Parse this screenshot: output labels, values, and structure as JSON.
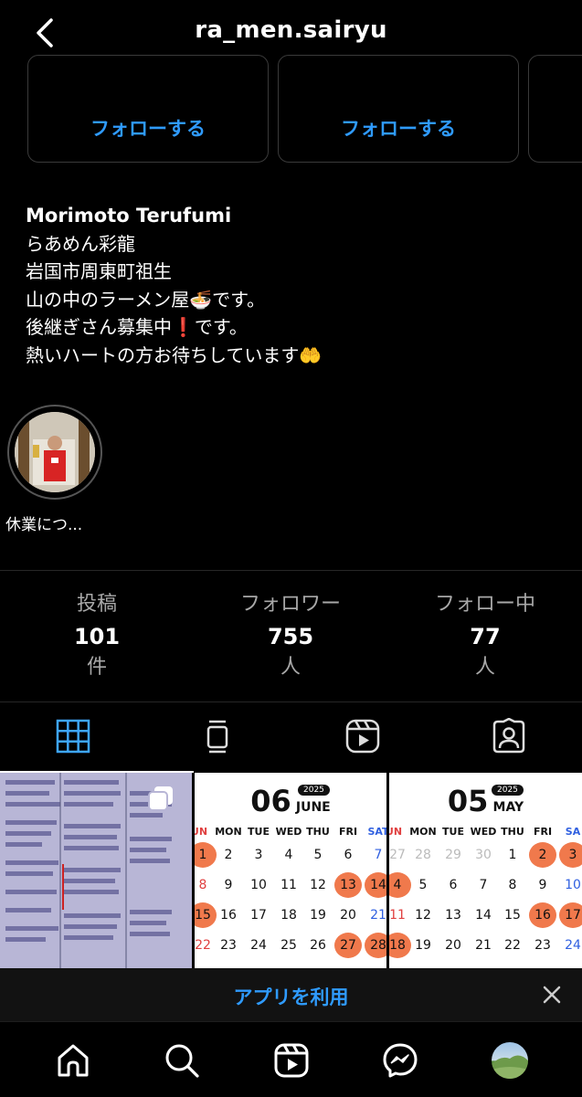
{
  "header": {
    "username": "ra_men.sairyu"
  },
  "suggestions": [
    {
      "follow_label": "フォローする"
    },
    {
      "follow_label": "フォローする"
    }
  ],
  "bio": {
    "name": "Morimoto Terufumi",
    "lines": [
      "らあめん彩龍",
      "岩国市周東町祖生",
      "山の中のラーメン屋🍜です。",
      "後継ぎさん募集中❗️です。",
      "熱いハートの方お待ちしています🤲"
    ]
  },
  "highlights": [
    {
      "label": "休業につ..."
    }
  ],
  "stats": [
    {
      "label": "投稿",
      "value": "101",
      "unit": "件"
    },
    {
      "label": "フォロワー",
      "value": "755",
      "unit": "人"
    },
    {
      "label": "フォロー中",
      "value": "77",
      "unit": "人"
    }
  ],
  "tabs": [
    "grid-icon",
    "feed-icon",
    "reels-icon",
    "tagged-icon"
  ],
  "grid": {
    "cal_june": {
      "month_num": "06",
      "month": "JUNE",
      "year": "2025"
    },
    "cal_may": {
      "month_num": "05",
      "month": "MAY",
      "year": "2025"
    },
    "weekdays": [
      "SUN",
      "MON",
      "TUE",
      "WED",
      "THU",
      "FRI",
      "SAT"
    ]
  },
  "banner": {
    "text": "アプリを利用"
  },
  "nav": [
    "home-icon",
    "search-icon",
    "reels-icon",
    "messenger-icon",
    "profile-avatar"
  ],
  "colors": {
    "link": "#2f9bff",
    "highlight": "#f0794c",
    "background": "#000000"
  }
}
